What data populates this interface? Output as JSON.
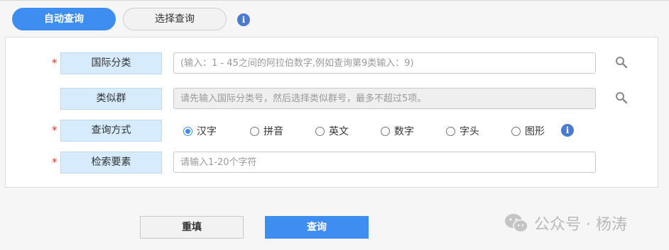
{
  "tabs": [
    {
      "label": "自动查询",
      "active": true
    },
    {
      "label": "选择查询",
      "active": false
    }
  ],
  "form": {
    "intl_class": {
      "label": "国际分类",
      "required": true,
      "placeholder": "(输入：1 - 45之间的阿拉伯数字,例如查询第9类输入：9)"
    },
    "similar_group": {
      "label": "类似群",
      "required": false,
      "placeholder": "请先输入国际分类号，然后选择类似群号，最多不超过5项。"
    },
    "query_method": {
      "label": "查询方式",
      "required": true,
      "options": [
        "汉字",
        "拼音",
        "英文",
        "数字",
        "字头",
        "图形"
      ],
      "selected": "汉字"
    },
    "search_element": {
      "label": "检索要素",
      "required": true,
      "placeholder": "请输入1-20个字符"
    }
  },
  "buttons": {
    "reset_label": "重填",
    "query_label": "查询"
  },
  "required_mark": "*",
  "info_glyph": "i",
  "watermark": {
    "text": "公众号 · 杨涛"
  },
  "colors": {
    "primary": "#3d8ef0",
    "label_bg": "#d6ebfb",
    "required": "#e5322d",
    "info": "#4a7bd1"
  }
}
